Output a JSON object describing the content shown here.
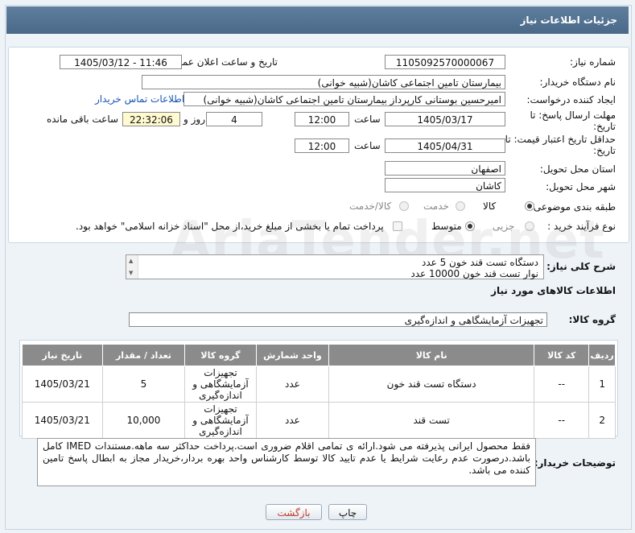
{
  "window": {
    "title": "جزئیات اطلاعات نیاز"
  },
  "fields": {
    "need_number_label": "شماره نیاز:",
    "need_number": "1105092570000067",
    "announce_label": "تاریخ و ساعت اعلان عمومی:",
    "announce_value": "1405/03/12 - 11:46",
    "buyer_org_label": "نام دستگاه خریدار:",
    "buyer_org": "بیمارستان تامین اجتماعی کاشان(شبیه خوانی)",
    "requester_label": "ایجاد کننده درخواست:",
    "requester": "امیرحسین بوستانی کارپرداز بیمارستان تامین اجتماعی کاشان(شبیه خوانی)",
    "contact_link": "اطلاعات تماس خریدار",
    "deadline_label": "مهلت ارسال پاسخ: تا تاریخ:",
    "deadline_date": "1405/03/17",
    "time_label": "ساعت",
    "deadline_time": "12:00",
    "days_value": "4",
    "days_label": "روز و",
    "remaining_time": "22:32:06",
    "remaining_label": "ساعت باقی مانده",
    "validity_label": "حداقل تاریخ اعتبار قیمت: تا تاریخ:",
    "validity_date": "1405/04/31",
    "validity_time_label": "ساعت",
    "validity_time": "12:00",
    "province_label": "استان محل تحویل:",
    "province": "اصفهان",
    "city_label": "شهر محل تحویل:",
    "city": "کاشان",
    "category_label": "طبقه بندی موضوعی:",
    "category_options": [
      "کالا",
      "خدمت",
      "کالا/خدمت"
    ],
    "process_label": "نوع فرآیند خرید :",
    "process_options": [
      "جزیی",
      "متوسط"
    ],
    "payment_note": "پرداخت تمام یا بخشی از مبلغ خرید،از محل \"اسناد خزانه اسلامی\" خواهد بود."
  },
  "description": {
    "label": "شرح کلی نیاز:",
    "line1": "دستگاه تست قند خون 5 عدد",
    "line2": "نوار تست قند خون 10000 عدد"
  },
  "goods": {
    "section_title": "اطلاعات کالاهای مورد نیاز",
    "group_label": "گروه کالا:",
    "group_value": "تجهیزات آزمایشگاهی و اندازه‌گیری",
    "headers": [
      "ردیف",
      "کد کالا",
      "نام کالا",
      "واحد شمارش",
      "گروه کالا",
      "تعداد / مقدار",
      "تاریخ نیاز"
    ],
    "rows": [
      {
        "idx": "1",
        "code": "--",
        "name": "دستگاه تست قند خون",
        "unit": "عدد",
        "group": "تجهیزات آزمایشگاهی و اندازه‌گیری",
        "qty": "5",
        "date": "1405/03/21"
      },
      {
        "idx": "2",
        "code": "--",
        "name": "تست قند",
        "unit": "عدد",
        "group": "تجهیزات آزمایشگاهی و اندازه‌گیری",
        "qty": "10,000",
        "date": "1405/03/21"
      }
    ]
  },
  "buyer_notes": {
    "label": "توضیحات خریدار:",
    "text": "فقط محصول ایرانی پذیرفته می شود.ارائه ی تمامی اقلام ضروری است.پرداخت حداکثر سه ماهه.مستندات IMED کامل باشد.درصورت عدم رعایت شرایط یا عدم تایید کالا توسط کارشناس واحد بهره بردار،خریدار مجاز به ابطال پاسخ تامین کننده می باشد."
  },
  "buttons": {
    "print": "چاپ",
    "back": "بازگشت"
  },
  "watermark": "AriaTender.net",
  "colors": {
    "titlebar": "#4f6e8e",
    "link": "#1a55b3",
    "back_text": "#c0392b"
  }
}
